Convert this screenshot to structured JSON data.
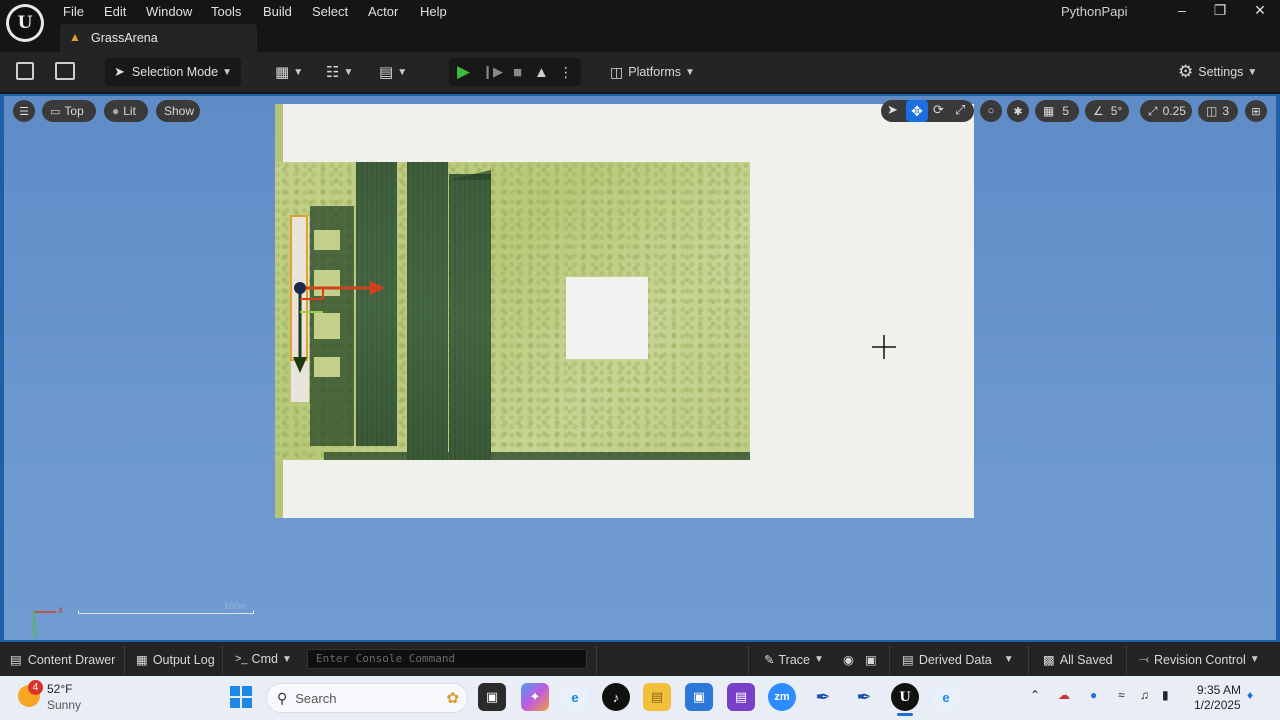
{
  "menu": {
    "items": [
      "File",
      "Edit",
      "Window",
      "Tools",
      "Build",
      "Select",
      "Actor",
      "Help"
    ],
    "project": "PythonPapi",
    "tab_title": "GrassArena"
  },
  "toolbar": {
    "selection_mode": "Selection Mode",
    "platforms": "Platforms",
    "settings": "Settings"
  },
  "viewport": {
    "view_mode": "Top",
    "lit": "Lit",
    "show": "Show",
    "grid_snap": "5",
    "rotation_snap": "5°",
    "scale_snap": "0.25",
    "camera_speed": "3",
    "scale_label": "100m",
    "axis_x": "x",
    "axis_y": "y"
  },
  "statusbar": {
    "content_drawer": "Content Drawer",
    "output_log": "Output Log",
    "cmd": "Cmd",
    "console_placeholder": "Enter Console Command",
    "trace": "Trace",
    "derived_data": "Derived Data",
    "all_saved": "All Saved",
    "revision_control": "Revision Control"
  },
  "taskbar": {
    "weather_temp": "52°F",
    "weather_desc": "Sunny",
    "weather_badge": "4",
    "search": "Search",
    "time": "9:35 AM",
    "date": "1/2/2025",
    "zoom_label": "zm"
  },
  "colors": {
    "accent_play": "#3dbb3d",
    "viewport_sky": "#6c97cf",
    "grass": "#c4d08a",
    "wall": "#456843",
    "gizmo_x": "#d3401a",
    "gizmo_y": "#1f3a10"
  }
}
